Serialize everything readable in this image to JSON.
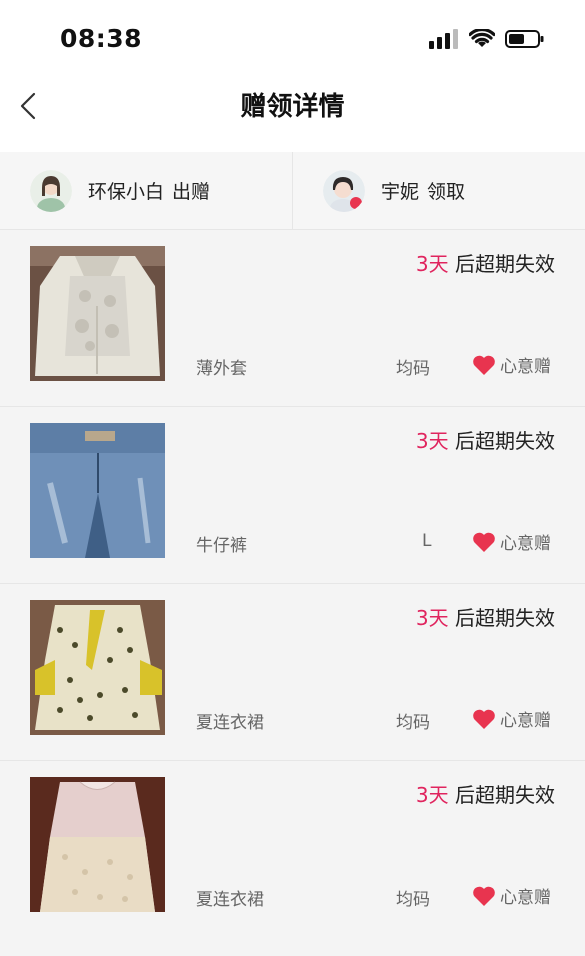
{
  "status_bar": {
    "time": "08:38"
  },
  "nav": {
    "title": "赠领详情"
  },
  "parties": {
    "giver": {
      "name": "环保小白",
      "role": "出赠"
    },
    "receiver": {
      "name": "宇妮",
      "role": "领取"
    }
  },
  "items": [
    {
      "expiry_days": "3天",
      "expiry_suffix": " 后超期失效",
      "name": "薄外套",
      "size": "均码",
      "gift_type": "心意赠"
    },
    {
      "expiry_days": "3天",
      "expiry_suffix": " 后超期失效",
      "name": "牛仔裤",
      "size": "L",
      "gift_type": "心意赠"
    },
    {
      "expiry_days": "3天",
      "expiry_suffix": " 后超期失效",
      "name": "夏连衣裙",
      "size": "均码",
      "gift_type": "心意赠"
    },
    {
      "expiry_days": "3天",
      "expiry_suffix": " 后超期失效",
      "name": "夏连衣裙",
      "size": "均码",
      "gift_type": "心意赠"
    }
  ],
  "colors": {
    "accent": "#e0245e",
    "heart": "#e8344f"
  }
}
